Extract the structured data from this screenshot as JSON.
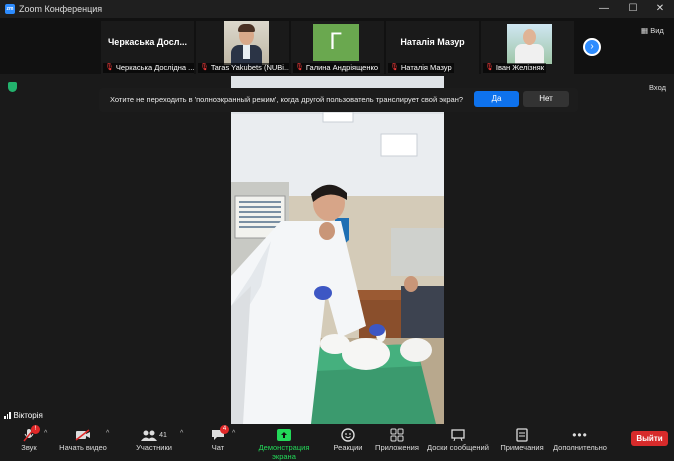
{
  "window": {
    "title": "Zoom Конференция",
    "minimize": "—",
    "maximize": "☐",
    "close": "✕"
  },
  "participants": [
    {
      "big_name": "Черкаська  Досл...",
      "label": "Черкаська Дослідна ..."
    },
    {
      "label": "Taras Yakubets (NUBi..."
    },
    {
      "avatar_letter": "Г",
      "label": "Галина Андріященко"
    },
    {
      "big_name": "Наталія Мазур",
      "label": "Наталія Мазур"
    },
    {
      "label": "Іван Желізняк"
    }
  ],
  "view_button": "Вид",
  "enter_button": "Вход",
  "notification": {
    "message": "Хотите не переходить в 'полноэкранный режим', когда другой пользователь транслирует свой экран?",
    "yes": "Да",
    "no": "Нет"
  },
  "active_speaker": "Вікторія",
  "toolbar": {
    "audio": "Звук",
    "audio_badge": "!",
    "video": "Начать видео",
    "participants": "Участники",
    "participants_count": "41",
    "chat": "Чат",
    "chat_badge": "4",
    "share": "Демонстрация экрана",
    "reactions": "Реакции",
    "apps": "Приложения",
    "whiteboards": "Доски сообщений",
    "notes": "Примечания",
    "more": "Дополнительно",
    "leave": "Выйти"
  },
  "colors": {
    "accent": "#2d8cff",
    "share_green": "#23d959",
    "leave_red": "#d72b2b",
    "badge_red": "#e02828"
  }
}
